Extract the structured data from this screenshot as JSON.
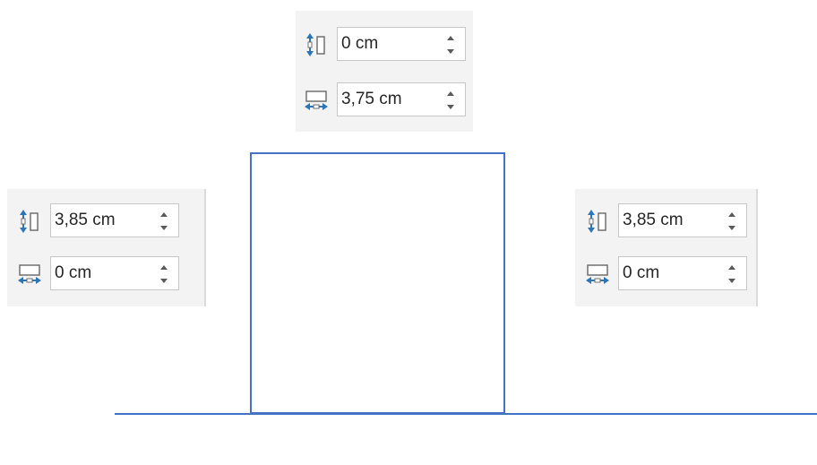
{
  "panels": [
    {
      "id": "top",
      "height_field": {
        "value": "0 cm"
      },
      "width_field": {
        "value": "3,75 cm"
      }
    },
    {
      "id": "left",
      "height_field": {
        "value": "3,85 cm"
      },
      "width_field": {
        "value": "0 cm"
      }
    },
    {
      "id": "right",
      "height_field": {
        "value": "3,85 cm"
      },
      "width_field": {
        "value": "0 cm"
      }
    }
  ],
  "colors": {
    "shape_outline": "#4472c4",
    "icon_arrow": "#2e75b6",
    "panel_background": "#f3f3f3"
  },
  "icons": {
    "height": "shape-height-icon",
    "width": "shape-width-icon",
    "spin_up": "chevron-up-icon",
    "spin_down": "chevron-down-icon"
  }
}
